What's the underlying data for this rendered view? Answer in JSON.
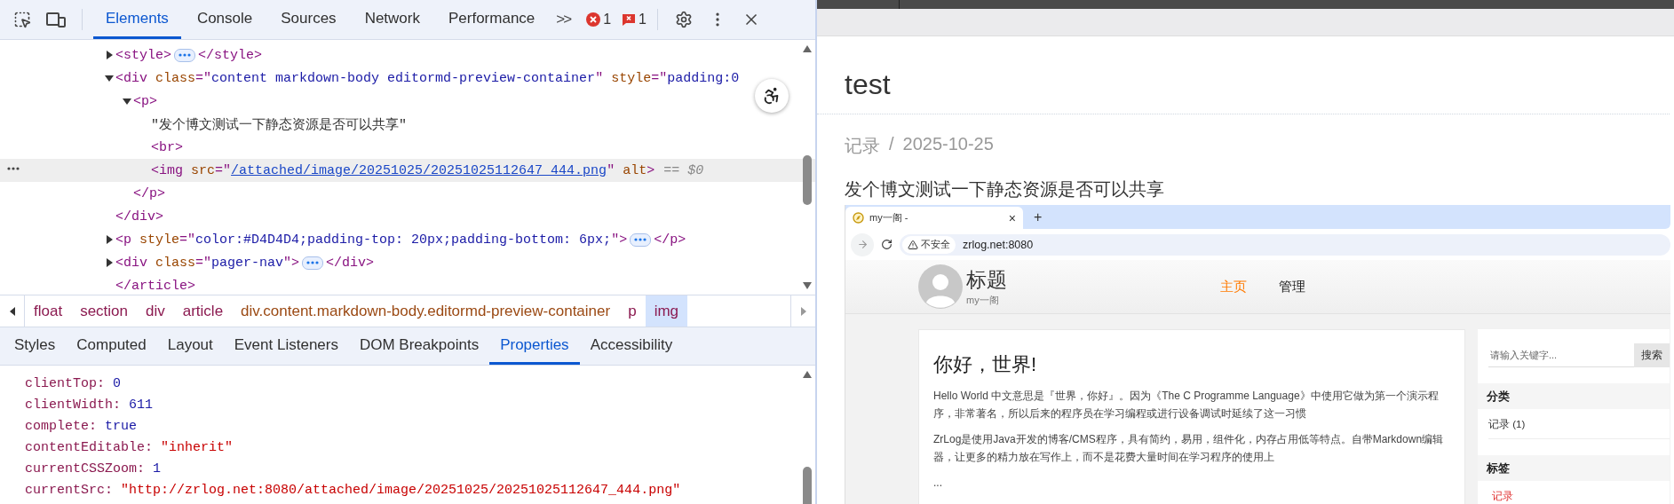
{
  "devtools": {
    "toolbar": {
      "tabs": [
        {
          "label": "Elements",
          "selected": true
        },
        {
          "label": "Console",
          "selected": false
        },
        {
          "label": "Sources",
          "selected": false
        },
        {
          "label": "Network",
          "selected": false
        },
        {
          "label": "Performance",
          "selected": false
        }
      ],
      "more": ">>",
      "error_count": "1",
      "issue_count": "1"
    },
    "dom_tree": [
      {
        "children": [
          {
            "expanded": false,
            "selected": false,
            "line": [
              {
                "kind": "code",
                "parts": [
                  {
                    "kind": "tag",
                    "t": "<style>"
                  }
                ]
              },
              {
                "kind": "ellipsis"
              },
              {
                "kind": "code",
                "parts": [
                  {
                    "kind": "tag",
                    "t": "</style>"
                  }
                ]
              }
            ]
          },
          {
            "expanded": true,
            "selected": false,
            "line": [
              {
                "kind": "code",
                "parts": [
                  {
                    "kind": "tag",
                    "t": "<div"
                  },
                  {
                    "kind": "attr",
                    "t": " class"
                  },
                  {
                    "kind": "tag",
                    "t": "=\""
                  },
                  {
                    "kind": "value",
                    "t": "content markdown-body editormd-preview-container"
                  },
                  {
                    "kind": "tag",
                    "t": "\""
                  },
                  {
                    "kind": "attr",
                    "t": " style"
                  },
                  {
                    "kind": "tag",
                    "t": "=\""
                  },
                  {
                    "kind": "value",
                    "t": "padding:0"
                  }
                ]
              }
            ],
            "children": [
              {
                "expanded": true,
                "selected": false,
                "line": [
                  {
                    "kind": "code",
                    "parts": [
                      {
                        "kind": "tag",
                        "t": "<p>"
                      }
                    ]
                  }
                ],
                "children": [
                  {
                    "selected": false,
                    "line": [
                      {
                        "kind": "code",
                        "parts": [
                          {
                            "kind": "text",
                            "t": "\"发个博文测试一下静态资源是否可以共享\""
                          }
                        ]
                      }
                    ]
                  },
                  {
                    "selected": false,
                    "line": [
                      {
                        "kind": "code",
                        "parts": [
                          {
                            "kind": "tag",
                            "t": "<br>"
                          }
                        ]
                      }
                    ]
                  },
                  {
                    "selected": true,
                    "line": [
                      {
                        "kind": "code",
                        "parts": [
                          {
                            "kind": "tag",
                            "t": "<img"
                          },
                          {
                            "kind": "attr",
                            "t": " src"
                          },
                          {
                            "kind": "tag",
                            "t": "=\""
                          },
                          {
                            "kind": "link",
                            "t": "/attached/image/20251025/20251025112647_444.png"
                          },
                          {
                            "kind": "tag",
                            "t": "\""
                          },
                          {
                            "kind": "attr",
                            "t": " alt"
                          },
                          {
                            "kind": "tag",
                            "t": ">"
                          }
                        ]
                      },
                      {
                        "kind": "note",
                        "text": "== $0"
                      }
                    ]
                  }
                ],
                "close": [
                  {
                    "kind": "code",
                    "parts": [
                      {
                        "kind": "tag",
                        "t": "</p>"
                      }
                    ]
                  }
                ]
              }
            ],
            "close": [
              {
                "kind": "code",
                "parts": [
                  {
                    "kind": "tag",
                    "t": "</div>"
                  }
                ]
              }
            ]
          },
          {
            "expanded": false,
            "selected": false,
            "line": [
              {
                "kind": "code",
                "parts": [
                  {
                    "kind": "tag",
                    "t": "<p"
                  },
                  {
                    "kind": "attr",
                    "t": " style"
                  },
                  {
                    "kind": "tag",
                    "t": "=\""
                  },
                  {
                    "kind": "value",
                    "t": "color:#D4D4D4;padding-top: 20px;padding-bottom: 6px;"
                  },
                  {
                    "kind": "tag",
                    "t": "\">"
                  }
                ]
              },
              {
                "kind": "ellipsis"
              },
              {
                "kind": "code",
                "parts": [
                  {
                    "kind": "tag",
                    "t": "</p>"
                  }
                ]
              }
            ]
          },
          {
            "expanded": false,
            "selected": false,
            "line": [
              {
                "kind": "code",
                "parts": [
                  {
                    "kind": "tag",
                    "t": "<div"
                  },
                  {
                    "kind": "attr",
                    "t": " class"
                  },
                  {
                    "kind": "tag",
                    "t": "=\""
                  },
                  {
                    "kind": "value",
                    "t": "pager-nav"
                  },
                  {
                    "kind": "tag",
                    "t": "\">"
                  }
                ]
              },
              {
                "kind": "ellipsis"
              },
              {
                "kind": "code",
                "parts": [
                  {
                    "kind": "tag",
                    "t": "</div>"
                  }
                ]
              }
            ]
          }
        ],
        "close": [
          {
            "kind": "code",
            "parts": [
              {
                "kind": "tag",
                "t": "</article>"
              }
            ]
          }
        ]
      }
    ],
    "breadcrumbs": [
      {
        "label": "float",
        "kind": "tag",
        "selected": false
      },
      {
        "label": "section",
        "kind": "tag",
        "selected": false
      },
      {
        "label": "div",
        "kind": "tag",
        "selected": false
      },
      {
        "label": "article",
        "kind": "tag",
        "selected": false
      },
      {
        "label": "div.content.markdown-body.editormd-preview-container",
        "kind": "class",
        "selected": false
      },
      {
        "label": "p",
        "kind": "tag",
        "selected": false
      },
      {
        "label": "img",
        "kind": "tag",
        "selected": true
      }
    ],
    "subtabs": [
      {
        "label": "Styles",
        "selected": false
      },
      {
        "label": "Computed",
        "selected": false
      },
      {
        "label": "Layout",
        "selected": false
      },
      {
        "label": "Event Listeners",
        "selected": false
      },
      {
        "label": "DOM Breakpoints",
        "selected": false
      },
      {
        "label": "Properties",
        "selected": true
      },
      {
        "label": "Accessibility",
        "selected": false
      }
    ],
    "properties": [
      {
        "name": "clientTop:",
        "value": "0",
        "kind": "number"
      },
      {
        "name": "clientWidth:",
        "value": "611",
        "kind": "number"
      },
      {
        "name": "complete:",
        "value": "true",
        "kind": "boolean"
      },
      {
        "name": "contentEditable:",
        "value": "\"inherit\"",
        "kind": "string"
      },
      {
        "name": "currentCSSZoom:",
        "value": "1",
        "kind": "number"
      },
      {
        "name": "currentSrc:",
        "value": "\"http://zrlog.net:8080/attached/image/20251025/20251025112647_444.png\"",
        "kind": "string"
      }
    ]
  },
  "page": {
    "title": "test",
    "meta": {
      "category": "记录",
      "separator": "/",
      "date": "2025-10-25"
    },
    "text": "发个博文测试一下静态资源是否可以共享",
    "image": {
      "tab": {
        "title": "my一阁 -",
        "close": "×",
        "new_tab": "+"
      },
      "address": {
        "security": "不安全",
        "url": "zrlog.net:8080"
      },
      "site": {
        "title": "标题",
        "subtitle": "my一阁",
        "nav": [
          {
            "label": "主页",
            "selected": true
          },
          {
            "label": "管理",
            "selected": false
          }
        ],
        "post": {
          "title": "你好，世界!",
          "paragraphs": [
            "Hello World 中文意思是『世界，你好』。因为《The C Programme Language》中使用它做为第一个演示程序，非常著名，所以后来的程序员在学习编程或进行设备调试时延续了这一习惯",
            "ZrLog是使用Java开发的博客/CMS程序，具有简约，易用，组件化，内存占用低等特点。自带Markdown编辑器，让更多的精力放在写作上，而不是花费大量时间在学习程序的使用上"
          ],
          "more": "..."
        },
        "sidebar": {
          "search_placeholder": "请输入关键字...",
          "search_button": "搜索",
          "sections": [
            {
              "title": "分类",
              "items": [
                {
                  "label": "记录 (1)",
                  "kind": "link"
                }
              ]
            },
            {
              "title": "标签",
              "items": [
                {
                  "label": "记录",
                  "kind": "tag"
                }
              ]
            }
          ]
        }
      }
    }
  }
}
